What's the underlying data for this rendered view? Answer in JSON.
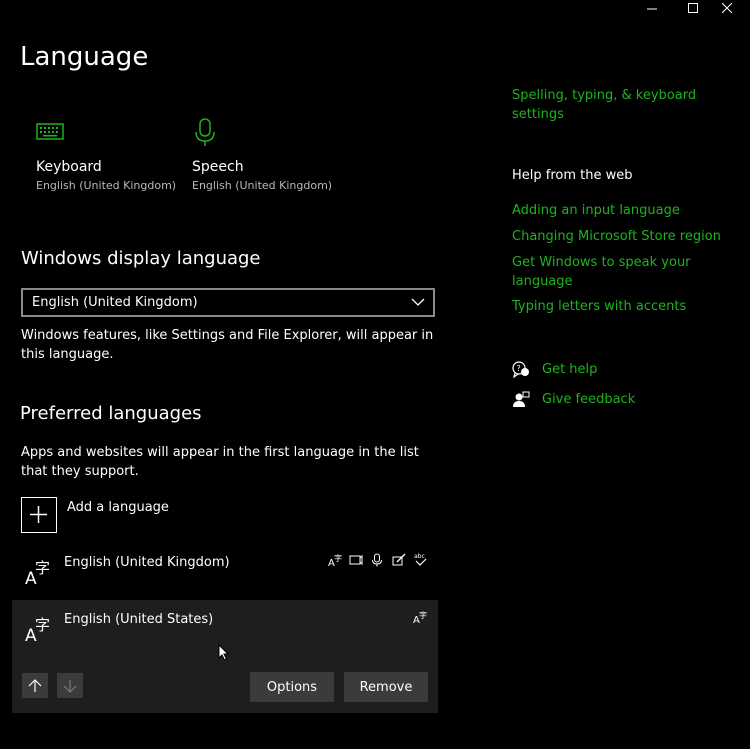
{
  "window": {
    "minimize_icon": "minimize-icon",
    "maximize_icon": "maximize-icon",
    "close_icon": "close-icon"
  },
  "page_title": "Language",
  "tiles": [
    {
      "label": "Keyboard",
      "sub": "English (United Kingdom)",
      "icon": "keyboard-icon"
    },
    {
      "label": "Speech",
      "sub": "English (United Kingdom)",
      "icon": "microphone-icon"
    }
  ],
  "display_language": {
    "heading": "Windows display language",
    "selected": "English (United Kingdom)",
    "description": "Windows features, like Settings and File Explorer, will appear in this language."
  },
  "preferred": {
    "heading": "Preferred languages",
    "description": "Apps and websites will appear in the first language in the list that they support.",
    "add_label": "Add a language",
    "languages": [
      {
        "name": "English (United Kingdom)",
        "feature_icons": [
          "display-language-icon",
          "text-to-speech-icon",
          "speech-recognition-icon",
          "handwriting-icon",
          "spell-check-icon"
        ]
      },
      {
        "name": "English (United States)",
        "feature_icons": [
          "display-language-icon"
        ]
      }
    ],
    "options_label": "Options",
    "remove_label": "Remove"
  },
  "sidebar": {
    "related_link": "Spelling, typing, & keyboard settings",
    "help_heading": "Help from the web",
    "help_links": [
      "Adding an input language",
      "Changing Microsoft Store region",
      "Get Windows to speak your language",
      "Typing letters with accents"
    ],
    "get_help": "Get help",
    "give_feedback": "Give feedback"
  },
  "colors": {
    "accent": "#1db31d",
    "selected_row_bg": "#1e1e1e",
    "button_bg": "#3b3b3b"
  }
}
